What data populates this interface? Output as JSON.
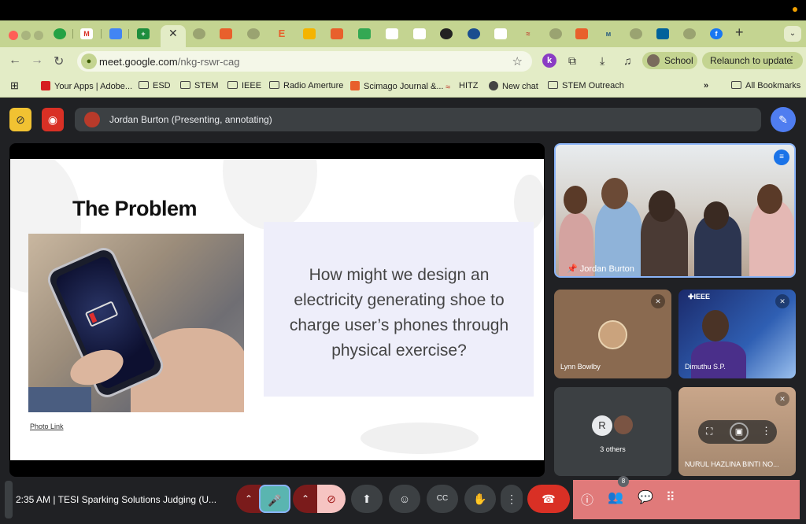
{
  "browser": {
    "url_host": "meet.google.com",
    "url_path": "/nkg-rswr-cag",
    "profile_label": "School",
    "relaunch_label": "Relaunch to update",
    "bookmarks": [
      {
        "label": "Your Apps | Adobe..."
      },
      {
        "label": "ESD"
      },
      {
        "label": "STEM"
      },
      {
        "label": "IEEE"
      },
      {
        "label": "Radio Amerture"
      },
      {
        "label": "Scimago Journal &..."
      },
      {
        "label": "HITZ"
      },
      {
        "label": "New chat"
      },
      {
        "label": "STEM Outreach"
      }
    ],
    "all_bookmarks_label": "All Bookmarks"
  },
  "meet": {
    "presenting_label": "Jordan Burton (Presenting, annotating)",
    "slide": {
      "title": "The Problem",
      "question": "How might we design an electricity generating shoe to charge user’s phones through physical exercise?",
      "photo_link": "Photo Link"
    },
    "participants": {
      "speaker_name": "Jordan Burton",
      "tile1_name": "Lynn Bowlby",
      "tile2_name": "Dimuthu S.P.",
      "tile2_banner": "IEEE",
      "others_initial": "R",
      "others_label": "3 others",
      "tile4_name": "NURUL HAZLINA BINTI NO..."
    },
    "meeting_time": "2:35 AM",
    "meeting_title": "TESI Sparking Solutions Judging (U...",
    "people_count": "8"
  },
  "colors": {
    "tab_strip": "#c4d491",
    "toolbar": "#e3ecc6",
    "meet_bg": "#202124",
    "end_call": "#d93025",
    "accent_blue": "#4f7df0",
    "right_panel": "#e07a7a"
  }
}
